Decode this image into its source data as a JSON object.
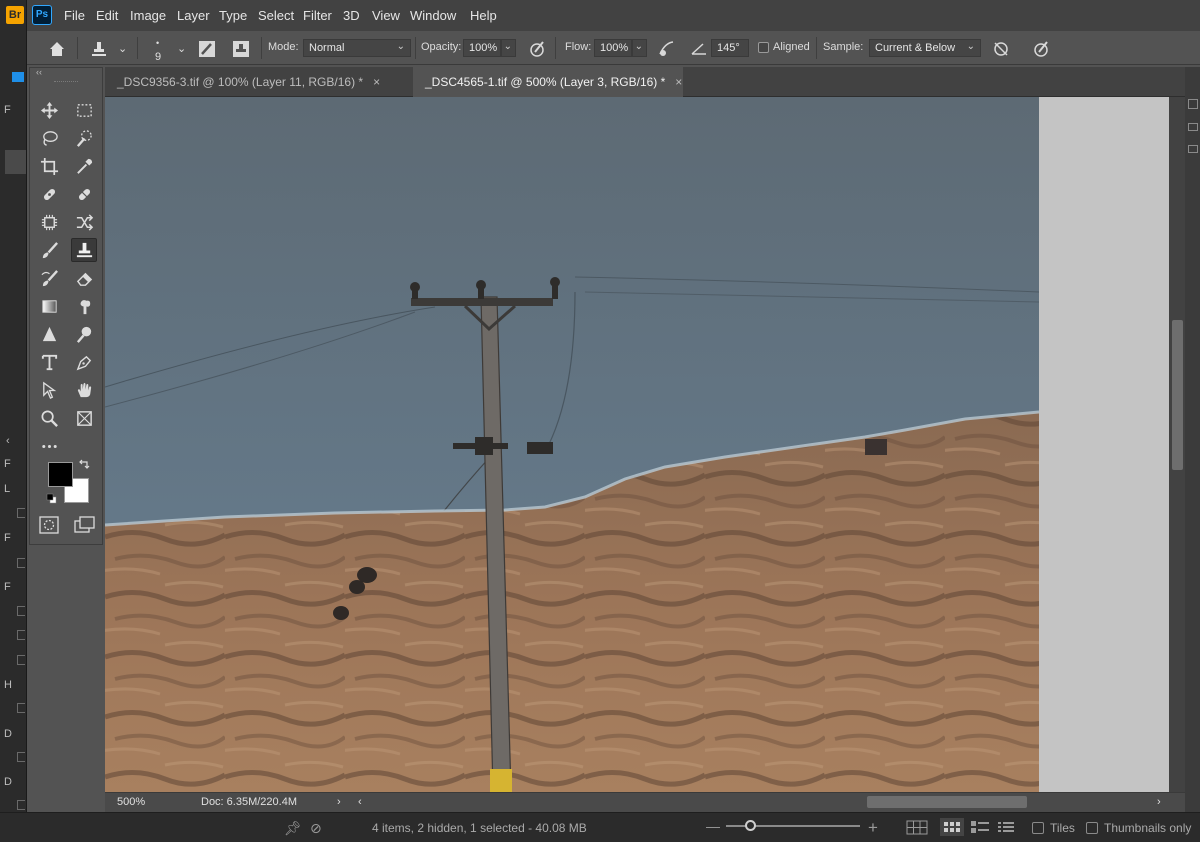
{
  "menubar": {
    "logo": "Ps",
    "items": [
      "File",
      "Edit",
      "Image",
      "Layer",
      "Type",
      "Select",
      "Filter",
      "3D",
      "View",
      "Window",
      "Help"
    ]
  },
  "options_bar": {
    "brush_size": "9",
    "mode_label": "Mode:",
    "mode_value": "Normal",
    "opacity_label": "Opacity:",
    "opacity_value": "100%",
    "flow_label": "Flow:",
    "flow_value": "100%",
    "angle_value": "145°",
    "aligned_label": "Aligned",
    "sample_label": "Sample:",
    "sample_value": "Current & Below"
  },
  "tabs": [
    {
      "label": "_DSC9356-3.tif @ 100% (Layer 11, RGB/16) *",
      "close": "×"
    },
    {
      "label": "_DSC4565-1.tif @ 500% (Layer 3, RGB/16) *",
      "close": "×"
    }
  ],
  "toolbar": {
    "collapse": "‹‹"
  },
  "status": {
    "zoom": "500%",
    "doc": "Doc: 6.35M/220.4M",
    "arrow": "›",
    "left_arrow": "‹",
    "right_arrow": "›"
  },
  "bridge": {
    "logo": "Br",
    "items_summary": "4 items, 2 hidden, 1 selected - 40.08 MB",
    "tiles_label": "Tiles",
    "thumbnails_label": "Thumbnails only",
    "left_letters": [
      "F",
      "L",
      "F",
      "F",
      "H",
      "D",
      "D"
    ]
  },
  "colors": {
    "accent": "#31a8ff",
    "foreground": "#000000",
    "background": "#ffffff"
  }
}
